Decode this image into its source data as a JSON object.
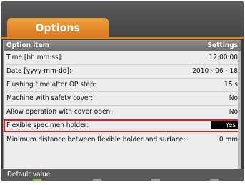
{
  "app": {
    "title": "Options"
  },
  "table": {
    "header_left": "Option item",
    "header_right": "Settings",
    "rows": [
      {
        "label": "Time [hh:mm:ss]:",
        "value": "12:00:00"
      },
      {
        "label": "Date [yyyy-mm-dd]:",
        "value": "2010 - 06 - 18"
      },
      {
        "label": "Flushing time after OP step:",
        "value": "15 s"
      },
      {
        "label": "Machine with safety cover:",
        "value": "No"
      },
      {
        "label": "Allow operation with cover open:",
        "value": "No"
      },
      {
        "label": "Flexible specimen holder:",
        "value": "Yes"
      },
      {
        "label": "Minimum distance between flexible holder and surface:",
        "value": "0 mm"
      }
    ],
    "selected_index": 5
  },
  "status": {
    "text": "Default value"
  },
  "colors": {
    "accent": "#e0841f",
    "selection_outline": "#e21b1b",
    "softkey_active": "#7cc242"
  }
}
